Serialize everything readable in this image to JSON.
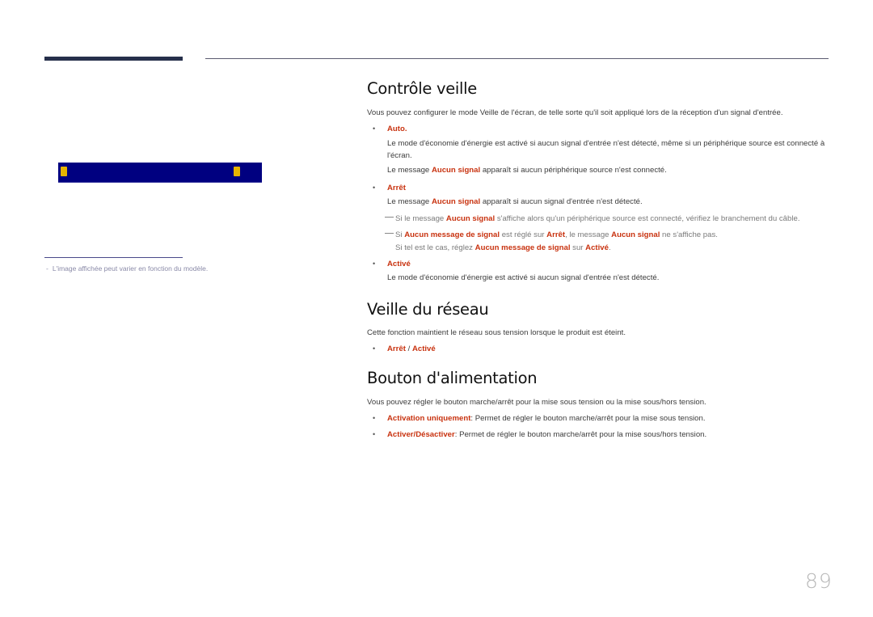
{
  "header": {
    "accent_color": "#262f4b"
  },
  "sidebar": {
    "screen_image": {
      "background_color": "#000080",
      "left_icon": "document-lock-icon",
      "right_icon": "warning-lock-icon"
    },
    "note_dash": "-",
    "note": "L'image affichée peut varier en fonction du modèle."
  },
  "colors": {
    "highlight": "#c8320f",
    "heading": "#111111",
    "body": "#3c3c3c"
  },
  "sections": {
    "controle_veille": {
      "title": "Contrôle veille",
      "intro": "Vous pouvez configurer le mode Veille de l'écran, de telle sorte qu'il soit appliqué lors de la réception d'un signal d'entrée.",
      "auto": {
        "label": "Auto.",
        "desc": "Le mode d'économie d'énergie est activé si aucun signal d'entrée n'est détecté, même si un périphérique source est connecté à l'écran.",
        "msg_pre": "Le message ",
        "msg_hl": "Aucun signal",
        "msg_post": " apparaît si aucun périphérique source n'est connecté."
      },
      "arret": {
        "label": "Arrêt",
        "msg_pre": "Le message ",
        "msg_hl": "Aucun signal",
        "msg_post": " apparaît si aucun signal d'entrée n'est détecté.",
        "note1_pre": "Si le message ",
        "note1_hl": "Aucun signal",
        "note1_post": " s'affiche alors qu'un périphérique source est connecté, vérifiez le branchement du câble.",
        "note2_pre": "Si ",
        "note2_hl1": "Aucun message de signal",
        "note2_mid1": " est réglé sur ",
        "note2_hl2": "Arrêt",
        "note2_mid2": ", le message ",
        "note2_hl3": "Aucun signal",
        "note2_post": " ne s'affiche pas.",
        "note3_pre": "Si tel est le cas, réglez ",
        "note3_hl1": "Aucun message de signal",
        "note3_mid": " sur ",
        "note3_hl2": "Activé",
        "note3_post": "."
      },
      "active": {
        "label": "Activé",
        "desc": "Le mode d'économie d'énergie est activé si aucun signal d'entrée n'est détecté."
      }
    },
    "veille_reseau": {
      "title": "Veille du réseau",
      "intro": "Cette fonction maintient le réseau sous tension lorsque le produit est éteint.",
      "opt1": "Arrêt",
      "sep": " / ",
      "opt2": "Activé"
    },
    "bouton_alimentation": {
      "title": "Bouton d'alimentation",
      "intro": "Vous pouvez régler le bouton marche/arrêt pour la mise sous tension ou la mise sous/hors tension.",
      "items": [
        {
          "label": "Activation uniquement",
          "desc": ": Permet de régler le bouton marche/arrêt pour la mise sous tension."
        },
        {
          "label": "Activer/Désactiver",
          "desc": ": Permet de régler le bouton marche/arrêt pour la mise sous/hors tension."
        }
      ]
    }
  },
  "footer": {
    "page_number": "89"
  }
}
